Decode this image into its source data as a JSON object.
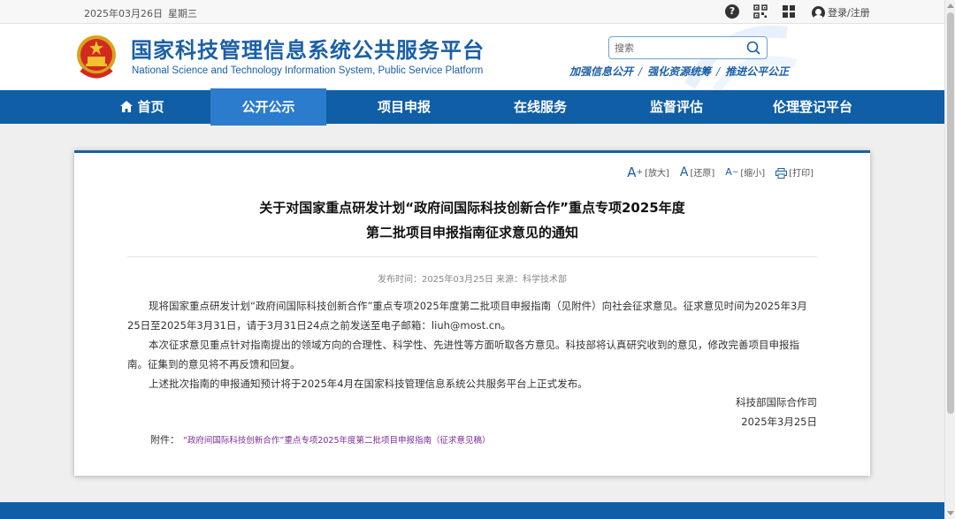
{
  "topbar": {
    "date": "2025年03月26日",
    "weekday": "星期三",
    "login_label": "登录/注册"
  },
  "header": {
    "title": "国家科技管理信息系统公共服务平台",
    "subtitle": "National Science and Technology Information System, Public Service Platform",
    "search_placeholder": "搜索",
    "slogans": [
      "加强信息公开",
      "强化资源统筹",
      "推进公平公正"
    ],
    "slogan_separator": "/"
  },
  "nav": {
    "items": [
      {
        "label": "首页"
      },
      {
        "label": "公开公示"
      },
      {
        "label": "项目申报"
      },
      {
        "label": "在线服务"
      },
      {
        "label": "监督评估"
      },
      {
        "label": "伦理登记平台"
      }
    ],
    "active_index": 1
  },
  "article": {
    "tools": {
      "enlarge": "[放大]",
      "restore": "[还原]",
      "shrink": "[缩小]",
      "print": "[打印]"
    },
    "title_line1": "关于对国家重点研发计划“政府间国际科技创新合作”重点专项2025年度",
    "title_line2": "第二批项目申报指南征求意见的通知",
    "meta": "发布时间：2025年03月25日 来源：科学技术部",
    "paragraphs": [
      "现将国家重点研发计划“政府间国际科技创新合作”重点专项2025年度第二批项目申报指南（见附件）向社会征求意见。征求意见时间为2025年3月25日至2025年3月31日，请于3月31日24点之前发送至电子邮箱：liuh@most.cn。",
      "本次征求意见重点针对指南提出的领域方向的合理性、科学性、先进性等方面听取各方意见。科技部将认真研究收到的意见，修改完善项目申报指南。征集到的意见将不再反馈和回复。",
      "上述批次指南的申报通知预计将于2025年4月在国家科技管理信息系统公共服务平台上正式发布。"
    ],
    "signature": "科技部国际合作司",
    "sign_date": "2025年3月25日",
    "attachment_label": "附件：",
    "attachment_link": "“政府间国际科技创新合作”重点专项2025年度第二批项目申报指南（征求意见稿）"
  },
  "colors": {
    "brand_blue": "#1b5fa6",
    "nav_blue": "#0f5ea6",
    "nav_active": "#2b7ccc",
    "link_purple": "#7a2a9a"
  }
}
